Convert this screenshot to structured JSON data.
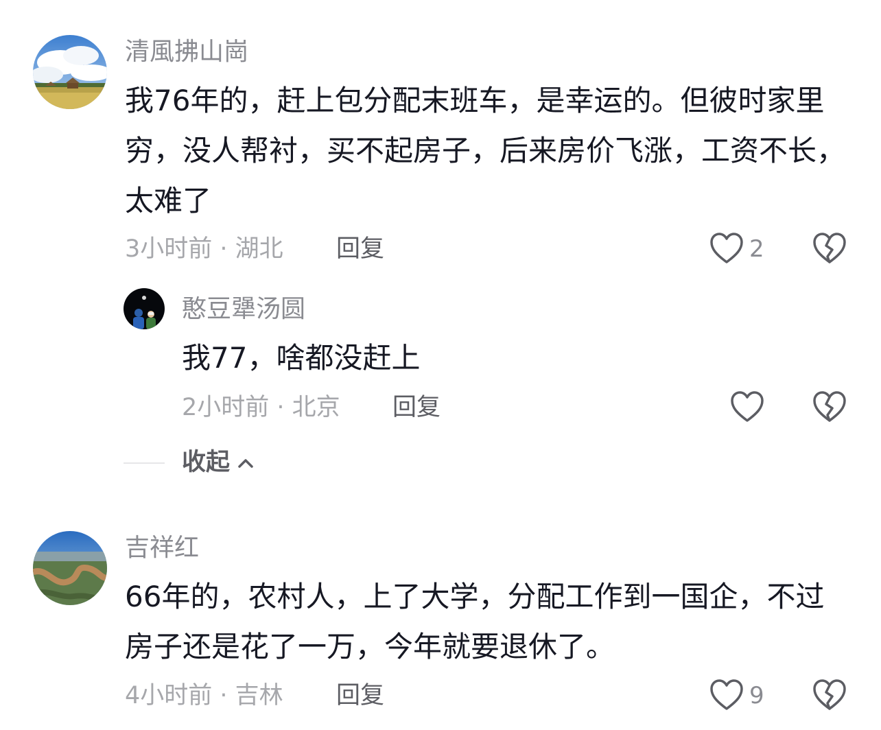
{
  "comments": [
    {
      "username": "清風拂山崗",
      "content": "我76年的，赶上包分配末班车，是幸运的。但彼时家里穷，没人帮衬，买不起房子，后来房价飞涨，工资不长，太难了",
      "time": "3小时前",
      "location": "湖北",
      "reply_label": "回复",
      "likes": "2",
      "avatar_icon": "landscape-avatar-icon",
      "replies": [
        {
          "username": "憨豆犟汤圆",
          "content": "我77，啥都没赶上",
          "time": "2小时前",
          "location": "北京",
          "reply_label": "回复",
          "likes": "",
          "avatar_icon": "night-people-avatar-icon"
        }
      ],
      "collapse_label": "收起"
    },
    {
      "username": "吉祥红",
      "content": "66年的，农村人，上了大学，分配工作到一国企，不过房子还是花了一万，今年就要退休了。",
      "time": "4小时前",
      "location": "吉林",
      "reply_label": "回复",
      "likes": "9",
      "avatar_icon": "river-valley-avatar-icon"
    }
  ],
  "separator": " · ",
  "icons": {
    "like": "heart-outline-icon",
    "dislike": "broken-heart-icon",
    "collapse": "chevron-up-icon"
  },
  "colors": {
    "text": "#161823",
    "username": "#8a8b91",
    "meta": "#a6a7ab",
    "reply": "#5c5d63"
  }
}
